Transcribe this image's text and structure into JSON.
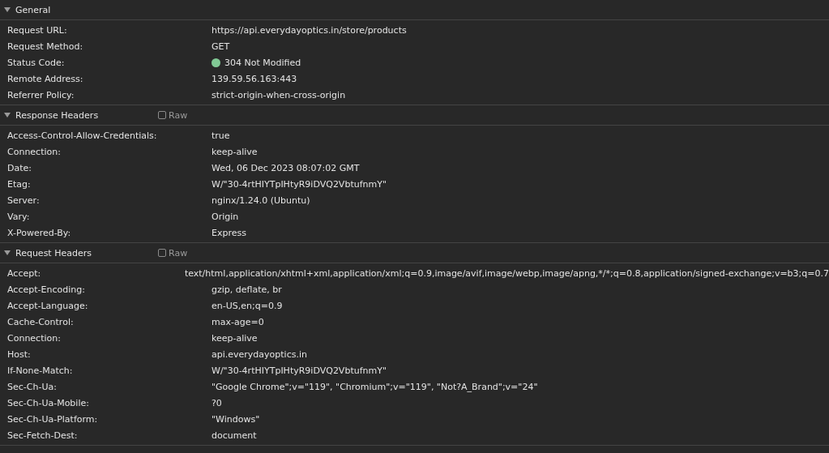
{
  "sections": [
    {
      "title": "General",
      "expanded": true,
      "rows": [
        {
          "name": "Request URL:",
          "value": "https://api.everydayoptics.in/store/products"
        },
        {
          "name": "Request Method:",
          "value": "GET"
        },
        {
          "name": "Status Code:",
          "value": "304 Not Modified",
          "color": "#81c995"
        },
        {
          "name": "Remote Address:",
          "value": "139.59.56.163:443"
        },
        {
          "name": "Referrer Policy:",
          "value": "strict-origin-when-cross-origin"
        }
      ]
    },
    {
      "title": "Response Headers",
      "expanded": true,
      "raw": {
        "label": "Raw",
        "checked": false
      },
      "rows": [
        {
          "name": "Access-Control-Allow-Credentials:",
          "value": "true"
        },
        {
          "name": "Connection:",
          "value": "keep-alive"
        },
        {
          "name": "Date:",
          "value": "Wed, 06 Dec 2023 08:07:02 GMT"
        },
        {
          "name": "Etag:",
          "value": "W/\"30-4rtHIYTpIHtyR9iDVQ2VbtufnmY\""
        },
        {
          "name": "Server:",
          "value": "nginx/1.24.0 (Ubuntu)"
        },
        {
          "name": "Vary:",
          "value": "Origin"
        },
        {
          "name": "X-Powered-By:",
          "value": "Express"
        }
      ]
    },
    {
      "title": "Request Headers",
      "expanded": true,
      "raw": {
        "label": "Raw",
        "checked": false
      },
      "rows": [
        {
          "name": "Accept:",
          "value": "text/html,application/xhtml+xml,application/xml;q=0.9,image/avif,image/webp,image/apng,*/*;q=0.8,application/signed-exchange;v=b3;q=0.7"
        },
        {
          "name": "Accept-Encoding:",
          "value": "gzip, deflate, br"
        },
        {
          "name": "Accept-Language:",
          "value": "en-US,en;q=0.9"
        },
        {
          "name": "Cache-Control:",
          "value": "max-age=0"
        },
        {
          "name": "Connection:",
          "value": "keep-alive"
        },
        {
          "name": "Host:",
          "value": "api.everydayoptics.in"
        },
        {
          "name": "If-None-Match:",
          "value": "W/\"30-4rtHIYTpIHtyR9iDVQ2VbtufnmY\""
        },
        {
          "name": "Sec-Ch-Ua:",
          "value": "\"Google Chrome\";v=\"119\", \"Chromium\";v=\"119\", \"Not?A_Brand\";v=\"24\""
        },
        {
          "name": "Sec-Ch-Ua-Mobile:",
          "value": "?0"
        },
        {
          "name": "Sec-Ch-Ua-Platform:",
          "value": "\"Windows\""
        },
        {
          "name": "Sec-Fetch-Dest:",
          "value": "document"
        }
      ]
    }
  ]
}
